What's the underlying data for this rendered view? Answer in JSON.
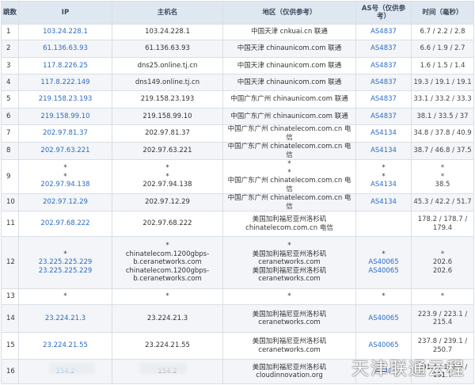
{
  "headers": {
    "hop": "跳数",
    "ip": "IP",
    "host": "主机名",
    "region": "地区（仅供参考）",
    "as": "AS号（仅供参考）",
    "time": "时间（毫秒）"
  },
  "rows": [
    {
      "hop": "1",
      "ip": [
        "103.24.228.1"
      ],
      "host": [
        "103.24.228.1"
      ],
      "region": [
        "中国天津 cnkuai.cn 联通"
      ],
      "as": [
        "AS4837"
      ],
      "time": [
        "6.7 / 2.2 / 2.8"
      ],
      "h": 20
    },
    {
      "hop": "2",
      "ip": [
        "61.136.63.93"
      ],
      "host": [
        "61.136.63.93"
      ],
      "region": [
        "中国天津 chinaunicom.com 联通"
      ],
      "as": [
        "AS4837"
      ],
      "time": [
        "6.6 / 1.9 / 2.7"
      ],
      "h": 22
    },
    {
      "hop": "3",
      "ip": [
        "117.8.226.25"
      ],
      "host": [
        "dns25.online.tj.cn"
      ],
      "region": [
        "中国天津 chinaunicom.com 联通"
      ],
      "as": [
        "AS4837"
      ],
      "time": [
        "1.6 / 1.5 / 1.4"
      ],
      "h": 21
    },
    {
      "hop": "4",
      "ip": [
        "117.8.222.149"
      ],
      "host": [
        "dns149.online.tj.cn"
      ],
      "region": [
        "中国天津 chinaunicom.com 联通"
      ],
      "as": [
        "AS4837"
      ],
      "time": [
        "19.3 / 19.1 / 19.1"
      ],
      "h": 21
    },
    {
      "hop": "5",
      "ip": [
        "219.158.23.193"
      ],
      "host": [
        "219.158.23.193"
      ],
      "region": [
        "中国广东广州 chinaunicom.com 联通"
      ],
      "as": [
        "AS4837"
      ],
      "time": [
        "33.1 / 33.2 / 33.3"
      ],
      "h": 22
    },
    {
      "hop": "6",
      "ip": [
        "219.158.99.10"
      ],
      "host": [
        "219.158.99.10"
      ],
      "region": [
        "中国广东广州 chinaunicom.com 联通"
      ],
      "as": [
        "AS4837"
      ],
      "time": [
        "38.1 / 33.5 / 37"
      ],
      "h": 21
    },
    {
      "hop": "7",
      "ip": [
        "202.97.81.37"
      ],
      "host": [
        "202.97.81.37"
      ],
      "region": [
        "中国广东广州 chinatelecom.com.cn 电信"
      ],
      "as": [
        "AS4134"
      ],
      "time": [
        "34.8 / 37.8 / 40.9"
      ],
      "h": 22
    },
    {
      "hop": "8",
      "ip": [
        "202.97.63.221"
      ],
      "host": [
        "202.97.63.221"
      ],
      "region": [
        "中国广东广州 chinatelecom.com.cn 电信"
      ],
      "as": [
        "AS4134"
      ],
      "time": [
        "38.7 / 46.8 / 37.5"
      ],
      "h": 22
    },
    {
      "hop": "9",
      "ip": [
        "*",
        "*",
        "202.97.94.138"
      ],
      "host": [
        "*",
        "*",
        "202.97.94.138"
      ],
      "region": [
        "*",
        "*",
        "中国广东广州 chinatelecom.com.cn 电信"
      ],
      "as": [
        "*",
        "*",
        "AS4134"
      ],
      "time": [
        "*",
        "*",
        "38.5"
      ],
      "h": 42
    },
    {
      "hop": "10",
      "ip": [
        "202.97.12.29"
      ],
      "host": [
        "202.97.12.29"
      ],
      "region": [
        "中国广东广州 chinatelecom.com.cn 电信"
      ],
      "as": [
        "AS4134"
      ],
      "time": [
        "45.3 / 42.2 / 51.7"
      ],
      "h": 21
    },
    {
      "hop": "11",
      "ip": [
        "202.97.68.222"
      ],
      "host": [
        "202.97.68.222"
      ],
      "region": [
        "美国加利福尼亚州洛杉矶",
        "chinatelecom.com.cn 电信"
      ],
      "as": [
        ""
      ],
      "time": [
        "178.2 / 178.7 /",
        "179.4"
      ],
      "h": 32
    },
    {
      "hop": "12",
      "ip": [
        "*",
        "23.225.225.229",
        "23.225.225.229"
      ],
      "host": [
        "*",
        "chinatelecom.1200gbps-",
        "b.ceranetworks.com",
        "chinatelecom.1200gbps-",
        "b.ceranetworks.com"
      ],
      "region": [
        "*",
        "美国加利福尼亚州洛杉矶 ceranetworks.com",
        "美国加利福尼亚州洛杉矶 ceranetworks.com"
      ],
      "as": [
        "*",
        "AS40065",
        "AS40065"
      ],
      "time": [
        "*",
        "202.6",
        "202.6"
      ],
      "h": 66
    },
    {
      "hop": "13",
      "ip": [
        "*"
      ],
      "host": [
        "*"
      ],
      "region": [
        "*"
      ],
      "as": [
        "*"
      ],
      "time": [
        "*"
      ],
      "h": 20
    },
    {
      "hop": "14",
      "ip": [
        "23.224.21.3"
      ],
      "host": [
        "23.224.21.3"
      ],
      "region": [
        "美国加利福尼亚州洛杉矶 ceranetworks.com"
      ],
      "as": [
        "AS40065"
      ],
      "time": [
        "223.9 / 223.1 /",
        "215.4"
      ],
      "h": 35
    },
    {
      "hop": "15",
      "ip": [
        "23.224.21.55"
      ],
      "host": [
        "23.224.21.55"
      ],
      "region": [
        "美国加利福尼亚州洛杉矶 ceranetworks.com"
      ],
      "as": [
        "AS40065"
      ],
      "time": [
        "237.8 / 239.1 /",
        "250.7"
      ],
      "h": 34
    },
    {
      "hop": "16",
      "ip": [
        "154.2"
      ],
      "host": [
        "154.2"
      ],
      "region": [
        "美国加利福尼亚州洛杉矶",
        "cloudinnovation.org"
      ],
      "as": [
        "AS40"
      ],
      "time": [
        "191.4 / 192.5 /",
        "191.7"
      ],
      "h": 31
    }
  ],
  "watermark": "天津联通云程",
  "colors": {
    "link": "#2a6cc4",
    "header_bg": "#dfe7f0",
    "alt_row": "#f3f5f8",
    "border": "#d9dfe6"
  }
}
